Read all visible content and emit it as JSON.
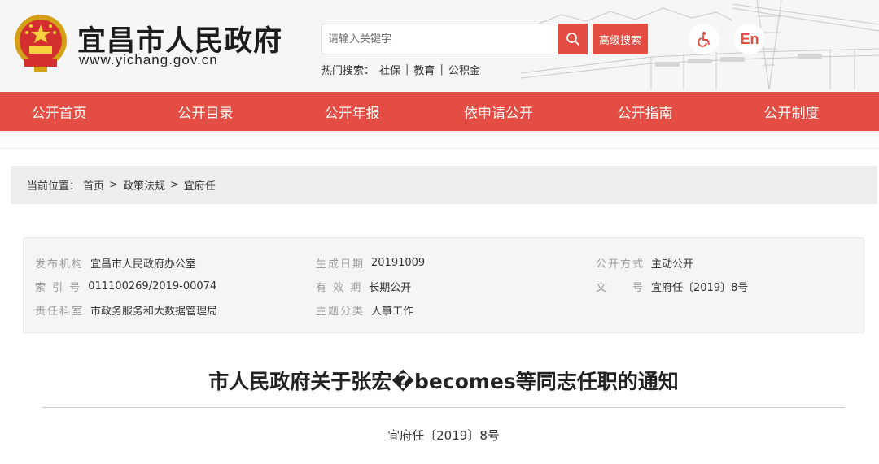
{
  "header": {
    "site_name": "宜昌市人民政府",
    "site_url": "www.yichang.gov.cn",
    "search": {
      "placeholder": "请输入关键字",
      "advanced_label": "高级搜索"
    },
    "hot_search": {
      "label": "热门搜索：",
      "items": [
        "社保",
        "教育",
        "公积金"
      ]
    },
    "english_label": "En",
    "accessibility_icon": "wheelchair-icon",
    "search_icon": "search-icon"
  },
  "colors": {
    "accent": "#e44d43",
    "breadcrumb_bg": "#eceef0",
    "info_bg": "#f5f5f5"
  },
  "nav": {
    "items": [
      "公开首页",
      "公开目录",
      "公开年报",
      "依申请公开",
      "公开指南",
      "公开制度"
    ]
  },
  "breadcrumb": {
    "label": "当前位置：",
    "items": [
      "首页",
      "政策法规",
      "宜府任"
    ]
  },
  "info": {
    "publisher_label": "发布机构",
    "publisher": "宜昌市人民政府办公室",
    "date_label": "生成日期",
    "date": "20191009",
    "method_label": "公开方式",
    "method": "主动公开",
    "index_label": "索 引 号",
    "index": "011100269/2019-00074",
    "validity_label": "有 效 期",
    "validity": "长期公开",
    "docno_label": "文　　号",
    "docno": "宜府任〔2019〕8号",
    "office_label": "责任科室",
    "office": "市政务服务和大数据管理局",
    "topic_label": "主题分类",
    "topic": "人事工作"
  },
  "article": {
    "title": "市人民政府关于张宏�becomes等同志任职的通知",
    "doc_number": "宜府任〔2019〕8号"
  }
}
